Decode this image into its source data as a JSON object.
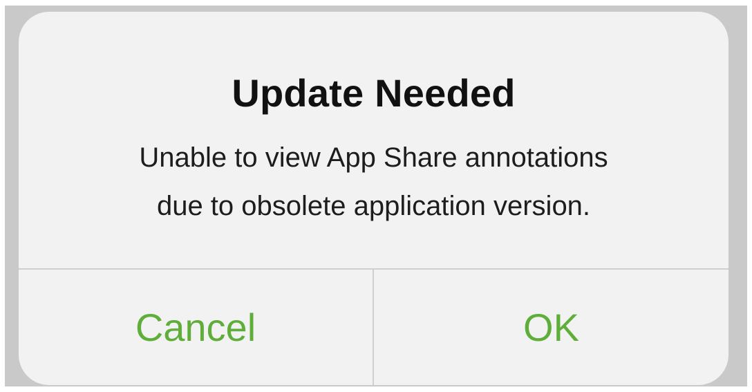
{
  "alert": {
    "title": "Update Needed",
    "message": "Unable to view App Share annotations\ndue to obsolete application version.",
    "buttons": {
      "cancel": "Cancel",
      "ok": "OK"
    }
  },
  "colors": {
    "accent": "#5fae3a",
    "dialog_background": "#f2f2f2",
    "backdrop": "#c9c9c9",
    "separator": "#cfcfcf",
    "text": "#111111"
  }
}
